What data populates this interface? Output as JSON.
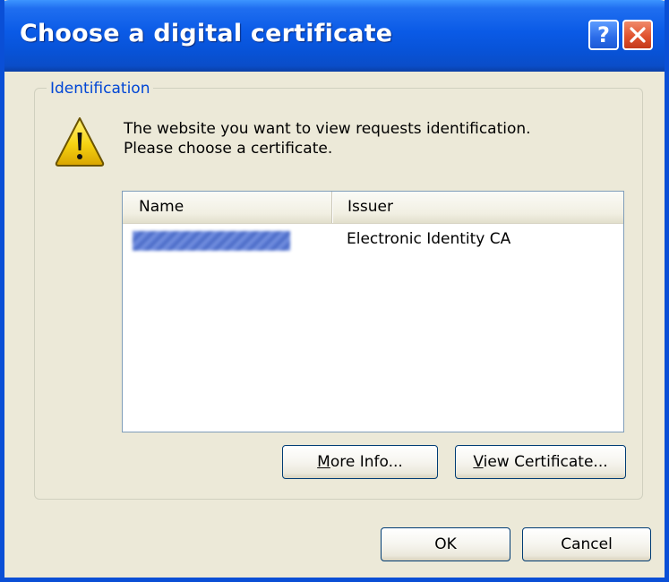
{
  "window": {
    "title": "Choose a digital certificate",
    "help_label": "?",
    "accent_color": "#0a5ae6"
  },
  "group": {
    "label": "Identification"
  },
  "message": {
    "line1": "The website you want to view requests identification.",
    "line2": "Please choose a certificate.",
    "icon": "warning-icon"
  },
  "list": {
    "columns": [
      "Name",
      "Issuer"
    ],
    "rows": [
      {
        "name": "",
        "issuer": "Electronic Identity CA"
      }
    ]
  },
  "buttons": {
    "more_info": {
      "mnemonic": "M",
      "rest": "ore Info..."
    },
    "view_certificate": {
      "mnemonic": "V",
      "rest": "iew Certificate..."
    },
    "ok": "OK",
    "cancel": "Cancel"
  }
}
